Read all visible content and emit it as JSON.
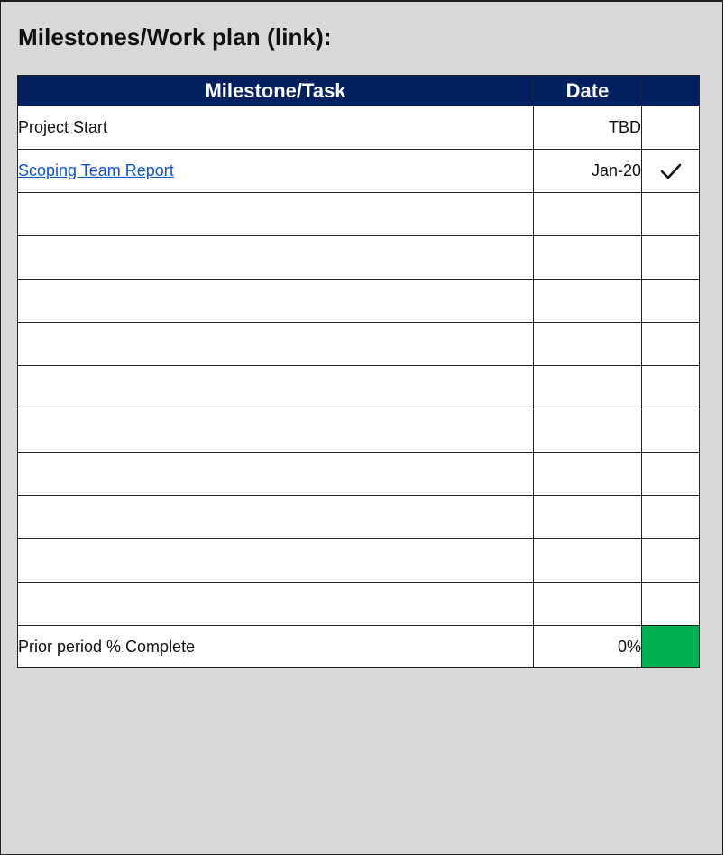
{
  "panel": {
    "title": "Milestones/Work plan (link):"
  },
  "table": {
    "headers": {
      "task": "Milestone/Task",
      "date": "Date",
      "status": ""
    },
    "rows": [
      {
        "task": "Project Start",
        "date": "TBD",
        "done": false,
        "is_link": false
      },
      {
        "task": "Scoping Team Report",
        "date": "Jan-20",
        "done": true,
        "is_link": true
      },
      {
        "task": "",
        "date": "",
        "done": false,
        "is_link": false
      },
      {
        "task": "",
        "date": "",
        "done": false,
        "is_link": false
      },
      {
        "task": "",
        "date": "",
        "done": false,
        "is_link": false
      },
      {
        "task": "",
        "date": "",
        "done": false,
        "is_link": false
      },
      {
        "task": "",
        "date": "",
        "done": false,
        "is_link": false
      },
      {
        "task": "",
        "date": "",
        "done": false,
        "is_link": false
      },
      {
        "task": "",
        "date": "",
        "done": false,
        "is_link": false
      },
      {
        "task": "",
        "date": "",
        "done": false,
        "is_link": false
      },
      {
        "task": "",
        "date": "",
        "done": false,
        "is_link": false
      },
      {
        "task": "",
        "date": "",
        "done": false,
        "is_link": false
      }
    ],
    "footer": {
      "label": "Prior period % Complete",
      "value": "0%",
      "status_color": "#00b050"
    }
  },
  "colors": {
    "header_bg": "#002060",
    "panel_bg": "#d9d9d9",
    "link": "#1155cc",
    "status_green": "#00b050"
  },
  "icons": {
    "done": "checkmark-icon"
  }
}
